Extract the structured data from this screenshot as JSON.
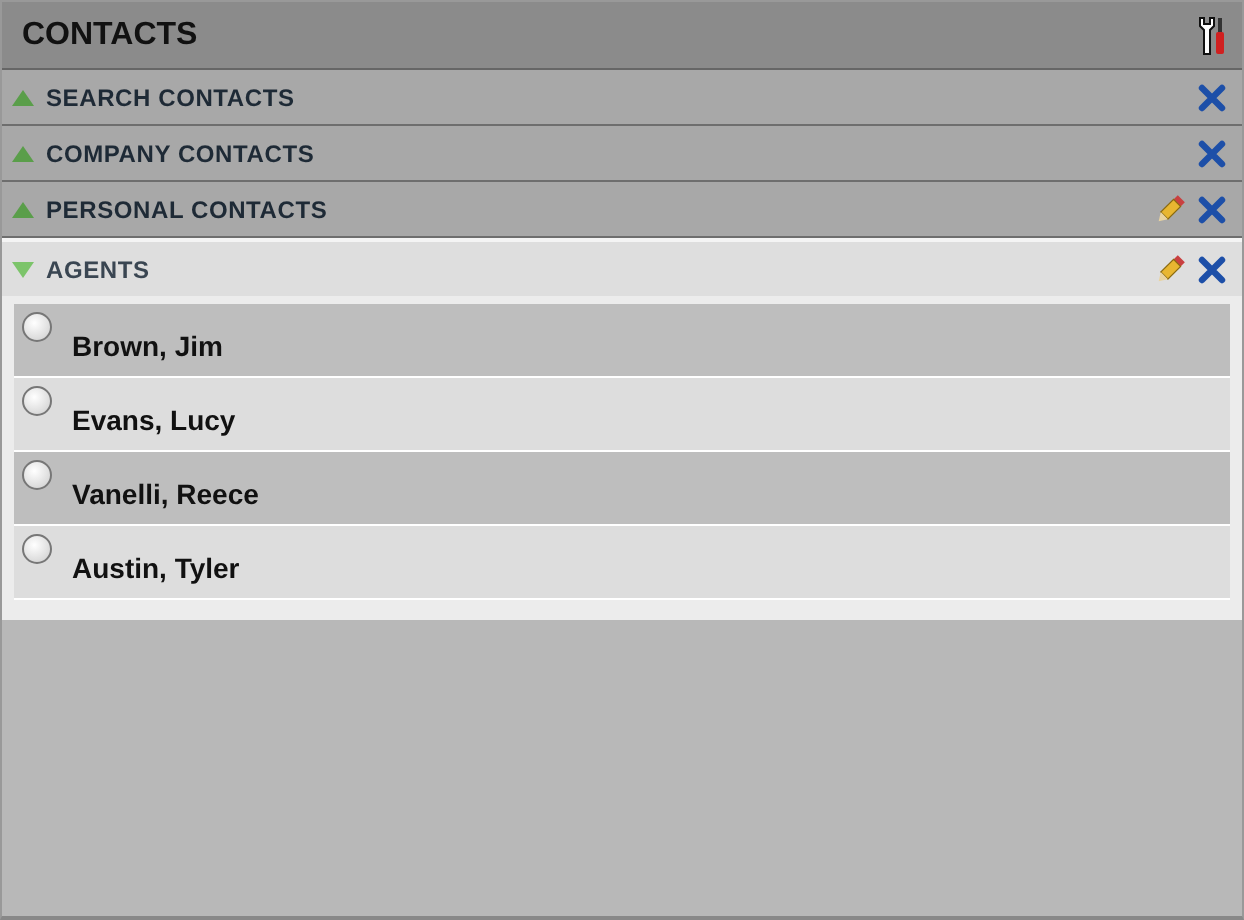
{
  "panel": {
    "title": "CONTACTS"
  },
  "sections": [
    {
      "label": "SEARCH CONTACTS",
      "expanded": false,
      "editable": false
    },
    {
      "label": "COMPANY CONTACTS",
      "expanded": false,
      "editable": false
    },
    {
      "label": "PERSONAL CONTACTS",
      "expanded": false,
      "editable": true
    },
    {
      "label": "AGENTS",
      "expanded": true,
      "editable": true,
      "contacts": [
        {
          "name": "Brown, Jim",
          "checked": false
        },
        {
          "name": "Evans, Lucy",
          "checked": false
        },
        {
          "name": "Vanelli, Reece",
          "checked": false
        },
        {
          "name": "Austin, Tyler",
          "checked": false
        }
      ]
    }
  ]
}
